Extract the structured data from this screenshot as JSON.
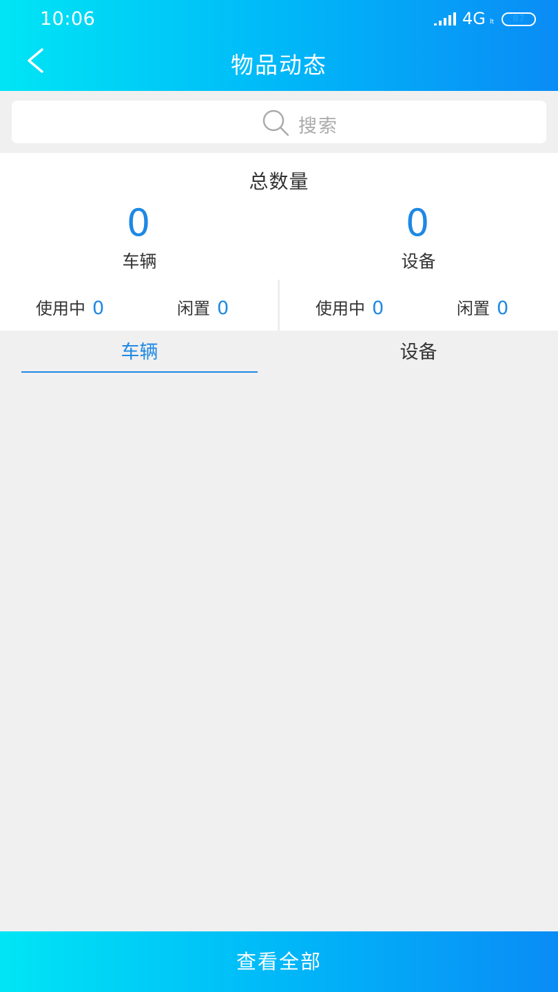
{
  "status_bar": {
    "time": "10:06",
    "network": "4G",
    "network_sub": "lt",
    "battery": "87",
    "battery_percent": 87,
    "signal_icon": "signal-bars-icon"
  },
  "header": {
    "title": "物品动态",
    "back_icon": "chevron-left-icon"
  },
  "search": {
    "placeholder": "搜索",
    "icon": "search-icon"
  },
  "summary": {
    "title": "总数量",
    "vehicles": {
      "total": "0",
      "label": "车辆",
      "in_use_label": "使用中",
      "in_use": "0",
      "idle_label": "闲置",
      "idle": "0"
    },
    "equipment": {
      "total": "0",
      "label": "设备",
      "in_use_label": "使用中",
      "in_use": "0",
      "idle_label": "闲置",
      "idle": "0"
    }
  },
  "tabs": [
    {
      "label": "车辆",
      "active": true
    },
    {
      "label": "设备",
      "active": false
    }
  ],
  "footer": {
    "view_all_label": "查看全部"
  },
  "colors": {
    "accent": "#1e88e5",
    "gradient_start": "#00e5f5",
    "gradient_end": "#0a8cf6",
    "background": "#f0f0f0"
  }
}
